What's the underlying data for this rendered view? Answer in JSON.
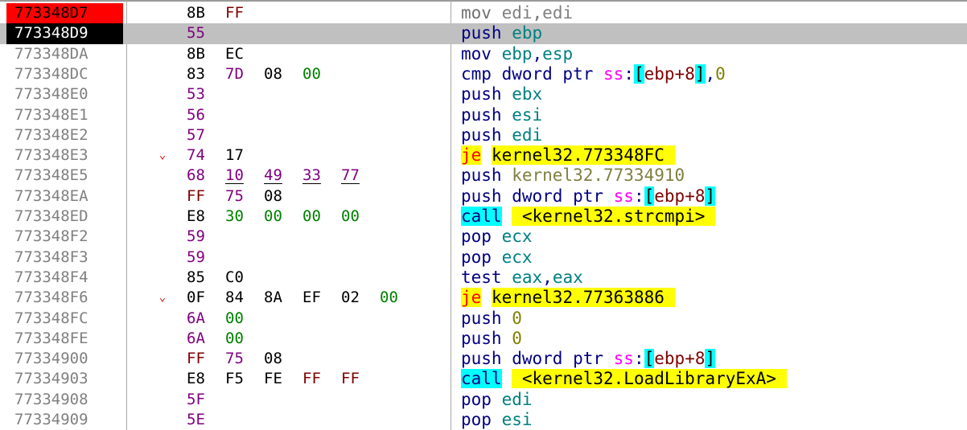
{
  "theme": {
    "row_height_hint": "25.3",
    "token_colors": {
      "mnem": "#000080",
      "mnem_dim": "#707070",
      "reg": "#008080",
      "reg_dim": "#808080",
      "kw": "#000080",
      "seg": "#ff00ff",
      "br": "#000000",
      "num": "#000000",
      "imm": "#808000",
      "sym": "#000000",
      "symdim": "#808040",
      "plain": "#000080",
      "jmp": "#ff0000"
    },
    "token_backgrounds": {
      "br": "#00ffff",
      "call": "#00ffff",
      "jmp": "#ffff00",
      "sym": "#ffff00"
    },
    "byte_colors": {
      "k": "#000000",
      "p": "#800080",
      "g": "#008000",
      "r": "#800000"
    }
  },
  "rows": [
    {
      "address": "773348D7",
      "addr_state": "ip",
      "bytes": [
        {
          "v": "8B",
          "c": "k"
        },
        {
          "v": "FF",
          "c": "r"
        }
      ],
      "tokens": [
        {
          "t": "mov ",
          "k": "mnem_dim"
        },
        {
          "t": "edi",
          "k": "reg_dim"
        },
        {
          "t": ",",
          "k": "mnem_dim"
        },
        {
          "t": "edi",
          "k": "reg_dim"
        }
      ]
    },
    {
      "address": "773348D9",
      "addr_state": "current",
      "selected": true,
      "bytes": [
        {
          "v": "55",
          "c": "p"
        }
      ],
      "tokens": [
        {
          "t": "push ",
          "k": "mnem"
        },
        {
          "t": "ebp",
          "k": "reg"
        }
      ]
    },
    {
      "address": "773348DA",
      "bytes": [
        {
          "v": "8B",
          "c": "k"
        },
        {
          "v": "EC",
          "c": "k"
        }
      ],
      "tokens": [
        {
          "t": "mov ",
          "k": "plain"
        },
        {
          "t": "ebp",
          "k": "reg"
        },
        {
          "t": ",",
          "k": "plain"
        },
        {
          "t": "esp",
          "k": "reg"
        }
      ]
    },
    {
      "address": "773348DC",
      "bytes": [
        {
          "v": "83",
          "c": "k"
        },
        {
          "v": "7D",
          "c": "p"
        },
        {
          "v": "08",
          "c": "k"
        },
        {
          "v": "00",
          "c": "g"
        }
      ],
      "tokens": [
        {
          "t": "cmp ",
          "k": "plain"
        },
        {
          "t": "dword ptr ",
          "k": "kw"
        },
        {
          "t": "ss",
          "k": "seg"
        },
        {
          "t": ":",
          "k": "plain"
        },
        {
          "t": "[",
          "k": "br"
        },
        {
          "t": "ebp+8",
          "k": "reg_br"
        },
        {
          "t": "]",
          "k": "br"
        },
        {
          "t": ",",
          "k": "plain"
        },
        {
          "t": "0",
          "k": "imm"
        }
      ]
    },
    {
      "address": "773348E0",
      "bytes": [
        {
          "v": "53",
          "c": "p"
        }
      ],
      "tokens": [
        {
          "t": "push ",
          "k": "mnem"
        },
        {
          "t": "ebx",
          "k": "reg"
        }
      ]
    },
    {
      "address": "773348E1",
      "bytes": [
        {
          "v": "56",
          "c": "p"
        }
      ],
      "tokens": [
        {
          "t": "push ",
          "k": "mnem"
        },
        {
          "t": "esi",
          "k": "reg"
        }
      ]
    },
    {
      "address": "773348E2",
      "bytes": [
        {
          "v": "57",
          "c": "p"
        }
      ],
      "tokens": [
        {
          "t": "push ",
          "k": "mnem"
        },
        {
          "t": "edi",
          "k": "reg"
        }
      ]
    },
    {
      "address": "773348E3",
      "arrow": "⌄",
      "bytes": [
        {
          "v": "74",
          "c": "p"
        },
        {
          "v": "17",
          "c": "k"
        }
      ],
      "tokens": [
        {
          "t": "je",
          "k": "jmp"
        },
        {
          "t": " ",
          "k": "plain"
        },
        {
          "t": "kernel32.773348FC ",
          "k": "sym"
        }
      ]
    },
    {
      "address": "773348E5",
      "underline": true,
      "bytes": [
        {
          "v": "68",
          "c": "p"
        },
        {
          "v": "10",
          "c": "p"
        },
        {
          "v": "49",
          "c": "p"
        },
        {
          "v": "33",
          "c": "p"
        },
        {
          "v": "77",
          "c": "p"
        }
      ],
      "tokens": [
        {
          "t": "push ",
          "k": "mnem"
        },
        {
          "t": "kernel32.77334910",
          "k": "symdim"
        }
      ]
    },
    {
      "address": "773348EA",
      "bytes": [
        {
          "v": "FF",
          "c": "r"
        },
        {
          "v": "75",
          "c": "p"
        },
        {
          "v": "08",
          "c": "k"
        }
      ],
      "tokens": [
        {
          "t": "push ",
          "k": "mnem"
        },
        {
          "t": "dword ptr ",
          "k": "kw"
        },
        {
          "t": "ss",
          "k": "seg"
        },
        {
          "t": ":",
          "k": "plain"
        },
        {
          "t": "[",
          "k": "br"
        },
        {
          "t": "ebp+8",
          "k": "reg_br"
        },
        {
          "t": "]",
          "k": "br"
        }
      ]
    },
    {
      "address": "773348ED",
      "bytes": [
        {
          "v": "E8",
          "c": "k"
        },
        {
          "v": "30",
          "c": "g"
        },
        {
          "v": "00",
          "c": "g"
        },
        {
          "v": "00",
          "c": "g"
        },
        {
          "v": "00",
          "c": "g"
        }
      ],
      "tokens": [
        {
          "t": "call",
          "k": "call"
        },
        {
          "t": " ",
          "k": "plain"
        },
        {
          "t": " <kernel32.strcmpi> ",
          "k": "sym"
        }
      ]
    },
    {
      "address": "773348F2",
      "bytes": [
        {
          "v": "59",
          "c": "p"
        }
      ],
      "tokens": [
        {
          "t": "pop ",
          "k": "mnem"
        },
        {
          "t": "ecx",
          "k": "reg"
        }
      ]
    },
    {
      "address": "773348F3",
      "bytes": [
        {
          "v": "59",
          "c": "p"
        }
      ],
      "tokens": [
        {
          "t": "pop ",
          "k": "mnem"
        },
        {
          "t": "ecx",
          "k": "reg"
        }
      ]
    },
    {
      "address": "773348F4",
      "bytes": [
        {
          "v": "85",
          "c": "k"
        },
        {
          "v": "C0",
          "c": "k"
        }
      ],
      "tokens": [
        {
          "t": "test ",
          "k": "plain"
        },
        {
          "t": "eax",
          "k": "reg"
        },
        {
          "t": ",",
          "k": "plain"
        },
        {
          "t": "eax",
          "k": "reg"
        }
      ]
    },
    {
      "address": "773348F6",
      "arrow": "⌄",
      "bytes": [
        {
          "v": "0F",
          "c": "k"
        },
        {
          "v": "84",
          "c": "k"
        },
        {
          "v": "8A",
          "c": "k"
        },
        {
          "v": "EF",
          "c": "k"
        },
        {
          "v": "02",
          "c": "k"
        },
        {
          "v": "00",
          "c": "g"
        }
      ],
      "tokens": [
        {
          "t": "je",
          "k": "jmp"
        },
        {
          "t": " ",
          "k": "plain"
        },
        {
          "t": "kernel32.77363886 ",
          "k": "sym"
        }
      ]
    },
    {
      "address": "773348FC",
      "bytes": [
        {
          "v": "6A",
          "c": "p"
        },
        {
          "v": "00",
          "c": "g"
        }
      ],
      "tokens": [
        {
          "t": "push ",
          "k": "mnem"
        },
        {
          "t": "0",
          "k": "imm"
        }
      ]
    },
    {
      "address": "773348FE",
      "bytes": [
        {
          "v": "6A",
          "c": "p"
        },
        {
          "v": "00",
          "c": "g"
        }
      ],
      "tokens": [
        {
          "t": "push ",
          "k": "mnem"
        },
        {
          "t": "0",
          "k": "imm"
        }
      ]
    },
    {
      "address": "77334900",
      "bytes": [
        {
          "v": "FF",
          "c": "r"
        },
        {
          "v": "75",
          "c": "p"
        },
        {
          "v": "08",
          "c": "k"
        }
      ],
      "tokens": [
        {
          "t": "push ",
          "k": "mnem"
        },
        {
          "t": "dword ptr ",
          "k": "kw"
        },
        {
          "t": "ss",
          "k": "seg"
        },
        {
          "t": ":",
          "k": "plain"
        },
        {
          "t": "[",
          "k": "br"
        },
        {
          "t": "ebp+8",
          "k": "reg_br"
        },
        {
          "t": "]",
          "k": "br"
        }
      ]
    },
    {
      "address": "77334903",
      "bytes": [
        {
          "v": "E8",
          "c": "k"
        },
        {
          "v": "F5",
          "c": "k"
        },
        {
          "v": "FE",
          "c": "k"
        },
        {
          "v": "FF",
          "c": "r"
        },
        {
          "v": "FF",
          "c": "r"
        }
      ],
      "tokens": [
        {
          "t": "call",
          "k": "call"
        },
        {
          "t": " ",
          "k": "plain"
        },
        {
          "t": " <kernel32.LoadLibraryExA> ",
          "k": "sym"
        }
      ]
    },
    {
      "address": "77334908",
      "bytes": [
        {
          "v": "5F",
          "c": "p"
        }
      ],
      "tokens": [
        {
          "t": "pop ",
          "k": "mnem"
        },
        {
          "t": "edi",
          "k": "reg"
        }
      ]
    },
    {
      "address": "77334909",
      "bytes": [
        {
          "v": "5E",
          "c": "p"
        }
      ],
      "tokens": [
        {
          "t": "pop ",
          "k": "mnem"
        },
        {
          "t": "esi",
          "k": "reg"
        }
      ]
    }
  ]
}
